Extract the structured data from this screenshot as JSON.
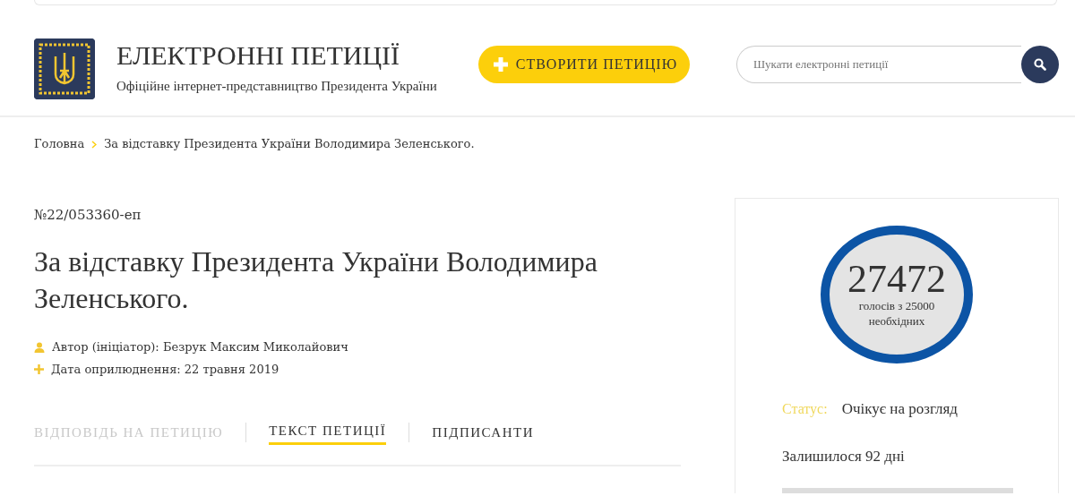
{
  "header": {
    "title": "ЕЛЕКТРОННІ ПЕТИЦІЇ",
    "subtitle": "Офіційне інтернет-представництво Президента України",
    "create_button": "СТВОРИТИ ПЕТИЦІЮ",
    "search": {
      "placeholder": "Шукати електронні петиції"
    }
  },
  "breadcrumb": [
    {
      "label": "Головна"
    },
    {
      "label": "За відставку Президента України Володимира Зеленського."
    }
  ],
  "petition": {
    "number": "№22/053360-еп",
    "title": "За відставку Президента України Володимира Зеленського.",
    "meta": [
      {
        "kind": "author",
        "text": "Автор (ініціатор): Безрук Максим Миколайович"
      },
      {
        "kind": "date",
        "text": "Дата оприлюднення: 22 травня 2019"
      }
    ],
    "tabs": [
      {
        "label": "ВІДПОВІДЬ НА ПЕТИЦІЮ",
        "selected": false,
        "disabled": true
      },
      {
        "label": "ТЕКСТ ПЕТИЦІЇ",
        "selected": true,
        "disabled": false
      },
      {
        "label": "ПІДПИСАНТИ",
        "selected": false,
        "disabled": false
      }
    ]
  },
  "votes": {
    "count": "27472",
    "caption": "голосів з 25000 необхідних",
    "status_label": "Статус:",
    "status_value": "Очікує на розгляд",
    "remaining": "Залишилося 92 дні"
  }
}
